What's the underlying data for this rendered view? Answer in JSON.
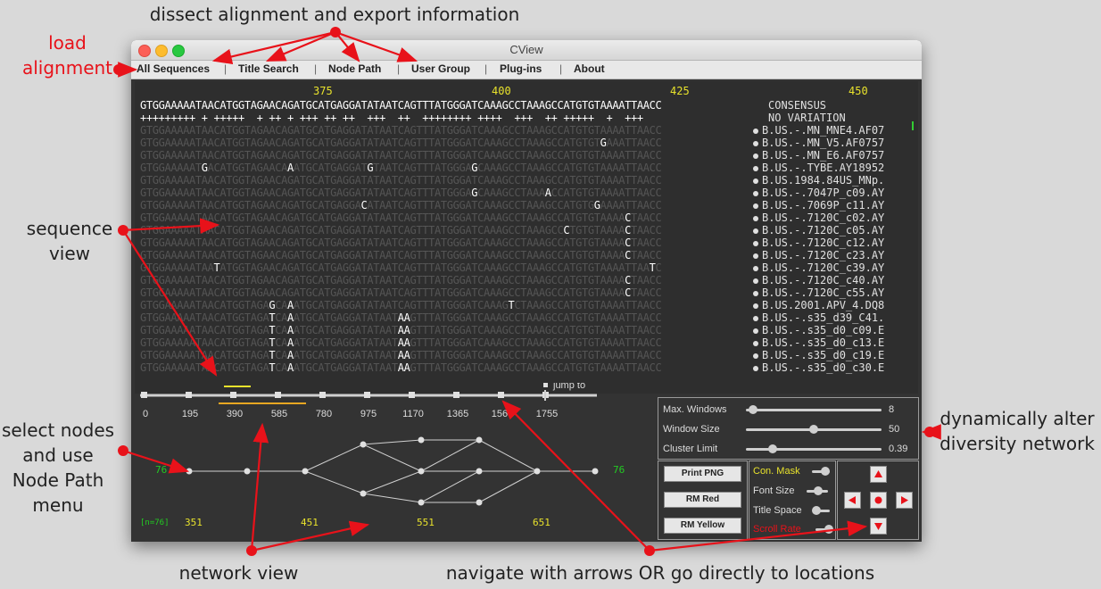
{
  "annotations": {
    "top": "dissect alignment and export information",
    "load": [
      "load",
      "alignment"
    ],
    "sequence_view": [
      "sequence",
      "view"
    ],
    "select_nodes": [
      "select nodes",
      "and  use",
      "Node Path",
      "menu"
    ],
    "network_view": "network view",
    "navigate": "navigate with arrows OR go directly to locations",
    "dynamic": [
      "dynamically alter",
      "diversity network"
    ]
  },
  "window": {
    "title": "CView"
  },
  "menu": [
    "All Sequences",
    "Title Search",
    "Node Path",
    "User Group",
    "Plug-ins",
    "About"
  ],
  "positions": [
    "375",
    "400",
    "425",
    "450"
  ],
  "consensus": {
    "sequence": "GTGGAAAAATAACATGGTAGAACAGATGCATGAGGATATAATCAGTTTATGGGATCAAAGCCTAAAGCCATGTGTAAAATTAACC",
    "variation": "+++++++++ + +++++  + ++ + +++ ++ ++  +++  ++  ++++++++ ++++  +++  ++ +++++  +  +++",
    "label_consensus": "CONSENSUS",
    "label_novar": "NO VARIATION"
  },
  "sequences": [
    {
      "name": "B.US.-.MN_MNE4.AF07",
      "muts": []
    },
    {
      "name": "B.US.-.MN_V5.AF0757",
      "muts": [
        [
          75,
          "G"
        ]
      ]
    },
    {
      "name": "B.US.-.MN_E6.AF0757",
      "muts": []
    },
    {
      "name": "B.US.-.TYBE.AY18952",
      "muts": [
        [
          10,
          "G"
        ],
        [
          24,
          "A"
        ],
        [
          37,
          "G"
        ],
        [
          54,
          "G"
        ]
      ]
    },
    {
      "name": "B.US.1984.84US_MNp.",
      "muts": []
    },
    {
      "name": "B.US.-.7047P_c09.AY",
      "muts": [
        [
          54,
          "G"
        ],
        [
          66,
          "A"
        ]
      ]
    },
    {
      "name": "B.US.-.7069P_c11.AY",
      "muts": [
        [
          36,
          "C"
        ],
        [
          74,
          "G"
        ]
      ]
    },
    {
      "name": "B.US.-.7120C_c02.AY",
      "muts": [
        [
          79,
          "C"
        ]
      ]
    },
    {
      "name": "B.US.-.7120C_c05.AY",
      "muts": [
        [
          69,
          "C"
        ],
        [
          79,
          "C"
        ]
      ]
    },
    {
      "name": "B.US.-.7120C_c12.AY",
      "muts": [
        [
          79,
          "C"
        ]
      ]
    },
    {
      "name": "B.US.-.7120C_c23.AY",
      "muts": [
        [
          79,
          "C"
        ]
      ]
    },
    {
      "name": "B.US.-.7120C_c39.AY",
      "muts": [
        [
          12,
          "T"
        ],
        [
          83,
          "T"
        ]
      ]
    },
    {
      "name": "B.US.-.7120C_c40.AY",
      "muts": [
        [
          79,
          "C"
        ]
      ]
    },
    {
      "name": "B.US.-.7120C_c55.AY",
      "muts": [
        [
          79,
          "C"
        ]
      ]
    },
    {
      "name": "B.US.2001.APV_4.DQ8",
      "muts": [
        [
          21,
          "G"
        ],
        [
          24,
          "A"
        ],
        [
          60,
          "T"
        ]
      ]
    },
    {
      "name": "B.US.-.s35_d39_C41.",
      "muts": [
        [
          21,
          "T"
        ],
        [
          24,
          "A"
        ],
        [
          42,
          "AA"
        ]
      ]
    },
    {
      "name": "B.US.-.s35_d0_c09.E",
      "muts": [
        [
          21,
          "T"
        ],
        [
          24,
          "A"
        ],
        [
          42,
          "AA"
        ]
      ]
    },
    {
      "name": "B.US.-.s35_d0_c13.E",
      "muts": [
        [
          21,
          "T"
        ],
        [
          24,
          "A"
        ],
        [
          42,
          "AA"
        ]
      ]
    },
    {
      "name": "B.US.-.s35_d0_c19.E",
      "muts": [
        [
          21,
          "T"
        ],
        [
          24,
          "A"
        ],
        [
          42,
          "AA"
        ]
      ]
    },
    {
      "name": "B.US.-.s35_d0_c30.E",
      "muts": [
        [
          21,
          "T"
        ],
        [
          24,
          "A"
        ],
        [
          42,
          "AA"
        ]
      ]
    }
  ],
  "location_slider": {
    "ticks": [
      "0",
      "195",
      "390",
      "585",
      "780",
      "975",
      "1170",
      "1365",
      "1560",
      "1755"
    ],
    "jump_label": "jump to"
  },
  "network": {
    "left_count": "76",
    "right_count": "76",
    "n_label": "[n=76]",
    "positions": [
      "351",
      "451",
      "551",
      "651"
    ]
  },
  "controls": {
    "max_windows": {
      "label": "Max. Windows",
      "value": "8",
      "fraction": 0.05
    },
    "window_size": {
      "label": "Window Size",
      "value": "50",
      "fraction": 0.5
    },
    "cluster_limit": {
      "label": "Cluster Limit",
      "value": "0.39",
      "fraction": 0.2
    }
  },
  "buttons": {
    "print": "Print PNG",
    "rm_red": "RM Red",
    "rm_yellow": "RM Yellow"
  },
  "toggles": {
    "con_mask": "Con. Mask",
    "font_size": "Font Size",
    "title_space": "Title Space",
    "scroll_rate": "Scroll Rate"
  },
  "colors": {
    "accent_red": "#e8121a",
    "consensus_yellow": "#e8e22c",
    "count_green": "#22cc22"
  }
}
